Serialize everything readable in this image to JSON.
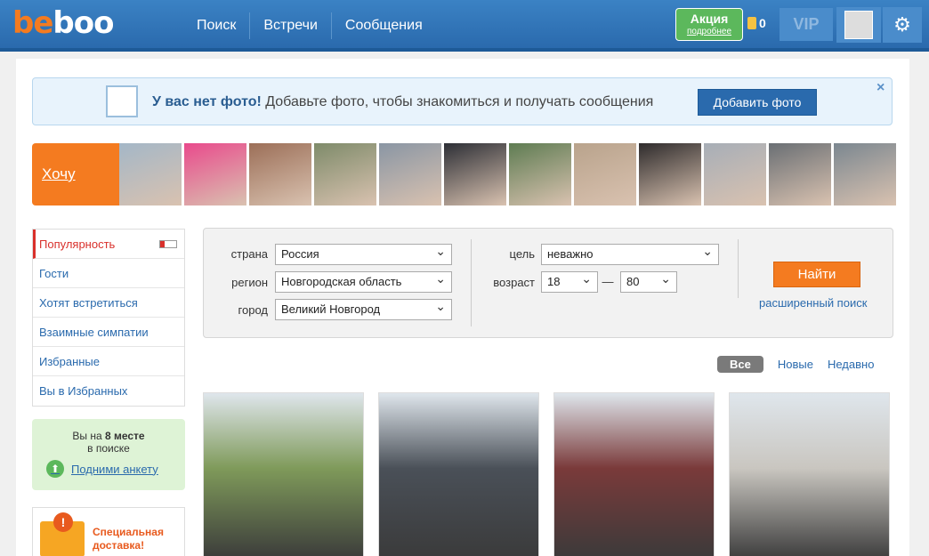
{
  "header": {
    "logo_be": "be",
    "logo_boo": "boo",
    "nav": [
      "Поиск",
      "Встречи",
      "Сообщения"
    ],
    "promo_title": "Акция",
    "promo_sub": "подробнее",
    "coins": "0",
    "vip": "VIP",
    "settings_icon": "gear-icon"
  },
  "notice": {
    "bold": "У вас нет фото!",
    "text": "Добавьте фото, чтобы знакомиться и получать сообщения",
    "button": "Добавить фото",
    "close": "×"
  },
  "strip": {
    "cta": "Хочу сюда!",
    "photo_colors": [
      "#a4b7c7",
      "#e94a8c",
      "#9c6f58",
      "#7e8b6a",
      "#8a96a4",
      "#2d2f36",
      "#5e7c52",
      "#b9a38c",
      "#2e2b2c",
      "#a7aeb7",
      "#6a6f74",
      "#7b8790"
    ]
  },
  "sidebar": {
    "menu": [
      "Популярность",
      "Гости",
      "Хотят встретиться",
      "Взаимные симпатии",
      "Избранные",
      "Вы в Избранных"
    ],
    "rank_pre": "Вы на",
    "rank_place": "8 месте",
    "rank_post": "в поиске",
    "rank_link": "Подними анкету",
    "special": "Специальная доставка!"
  },
  "search": {
    "country_label": "страна",
    "country_value": "Россия",
    "region_label": "регион",
    "region_value": "Новгородская область",
    "city_label": "город",
    "city_value": "Великий Новгород",
    "goal_label": "цель",
    "goal_value": "неважно",
    "age_label": "возраст",
    "age_from": "18",
    "age_to": "80",
    "dash": "—",
    "find_button": "Найти",
    "advanced_link": "расширенный поиск"
  },
  "filters": [
    "Все",
    "Новые",
    "Недавно"
  ],
  "cards": [
    "#7f9a5a",
    "#4a5058",
    "#7a3a3a",
    "#c9c6c0"
  ]
}
